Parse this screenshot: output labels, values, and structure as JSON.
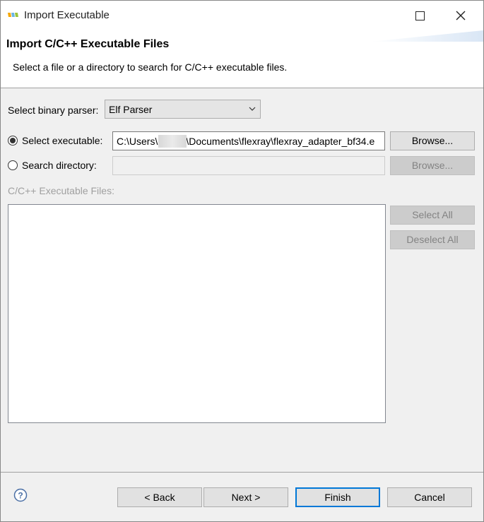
{
  "window": {
    "title": "Import Executable",
    "icon": "nxp-app-icon",
    "maximize_icon": "maximize-icon",
    "close_icon": "close-icon"
  },
  "banner": {
    "title": "Import C/C++ Executable Files",
    "description": "Select a file or a directory to search for C/C++ executable files."
  },
  "form": {
    "parser_label": "Select binary parser:",
    "parser_value": "Elf Parser",
    "select_exe_label": "Select executable:",
    "select_exe_checked": true,
    "exe_path_prefix": "C:\\Users\\",
    "exe_path_suffix": "\\Documents\\flexray\\flexray_adapter_bf34.e",
    "browse_exe_label": "Browse...",
    "search_dir_label": "Search directory:",
    "search_dir_checked": false,
    "search_dir_value": "",
    "browse_dir_label": "Browse...",
    "files_label": "C/C++ Executable Files:",
    "files": [],
    "select_all_label": "Select All",
    "deselect_all_label": "Deselect All"
  },
  "footer": {
    "help_icon": "help-icon",
    "back_label": "< Back",
    "next_label": "Next >",
    "finish_label": "Finish",
    "cancel_label": "Cancel"
  },
  "colors": {
    "accent": "#0078d7",
    "disabled_text": "#a0a0a0"
  }
}
